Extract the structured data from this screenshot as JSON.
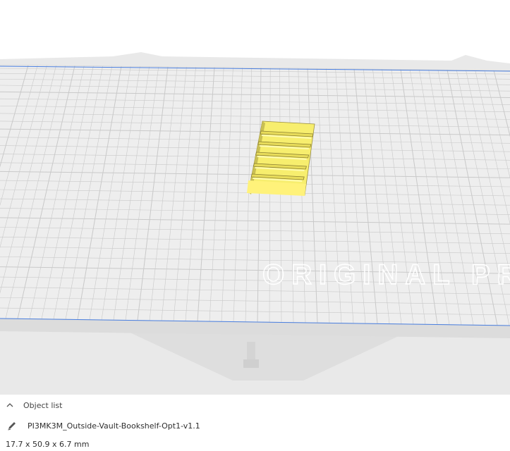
{
  "viewport": {
    "bed_watermark": "ORIGINAL PRU",
    "model_color": "#f7ee6e",
    "grid_line_color": "#c9c9c9",
    "bed_edge_color": "#4a7fe0"
  },
  "object_panel": {
    "header_label": "Object list",
    "header_icon": "chevron-up-icon",
    "object_icon": "pencil-icon",
    "object_name": "PI3MK3M_Outside-Vault-Bookshelf-Opt1-v1.1",
    "dimensions": "17.7 x 50.9 x 6.7 mm"
  }
}
